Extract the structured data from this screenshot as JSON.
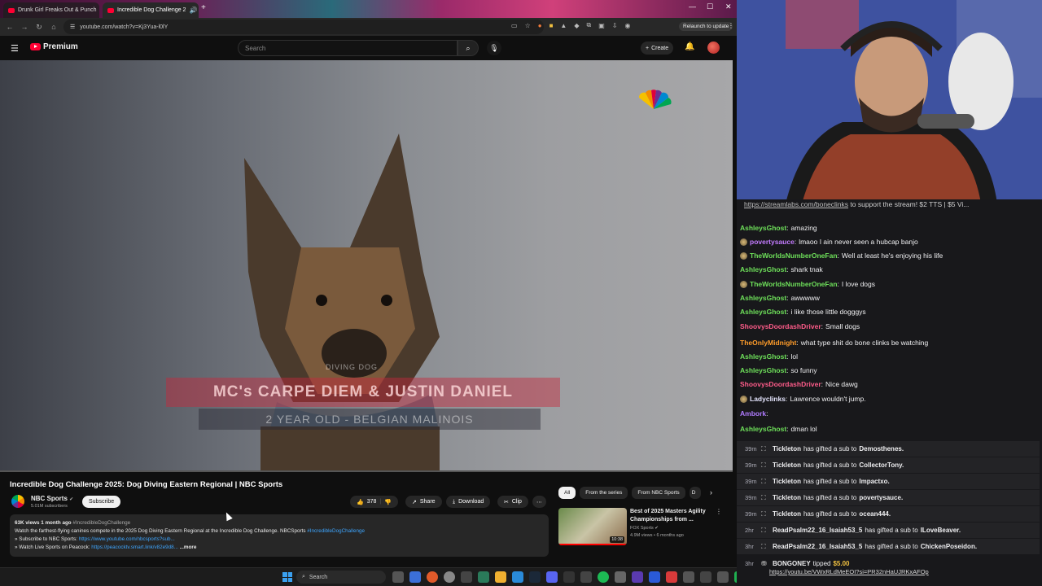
{
  "browser": {
    "tabs": [
      {
        "label": "Drunk Girl Freaks Out & Punch",
        "active": false
      },
      {
        "label": "Incredible Dog Challenge 2",
        "active": true
      }
    ],
    "url": "youtube.com/watch?v=Kj3Yua-l0lY",
    "relaunch_label": "Relaunch to update"
  },
  "youtube": {
    "logo_label": "Premium",
    "search_placeholder": "Search",
    "create_label": "Create",
    "video": {
      "caption_main": "MC's CARPE DIEM & JUSTIN DANIEL",
      "caption_sub": "2 YEAR OLD - BELGIAN MALINOIS",
      "caption_small": "DIVING DOG",
      "title": "Incredible Dog Challenge 2025: Dog Diving Eastern Regional | NBC Sports"
    },
    "channel": {
      "name": "NBC Sports",
      "subscribers": "5.01M subscribers",
      "subscribe_label": "Subscribe"
    },
    "actions": {
      "likes": "378",
      "share": "Share",
      "download": "Download",
      "clip": "Clip"
    },
    "description": {
      "meta": "63K views  1 month ago",
      "meta_tag": "#IncredibleDogChallenge",
      "line1": "Watch the farthest-flying canines compete in the 2025 Dog Diving Eastern Regional at the Incredible Dog Challenge. NBCSports",
      "line1_tag": "#IncredibleDogChallenge",
      "line2": "» Subscribe to NBC Sports:",
      "line2_link": "https://www.youtube.com/nbcsports?sub...",
      "line3": "» Watch Live Sports on Peacock:",
      "line3_link": "https://peacocktv.smart.link/v82e9d8...",
      "more": "...more"
    },
    "chips": [
      "All",
      "From the series",
      "From NBC Sports",
      "D"
    ],
    "recommended": {
      "title": "Best of 2025 Masters Agility Championships from ...",
      "channel": "FOX Sports",
      "meta": "4.9M views • 6 months ago",
      "duration": "10:38"
    }
  },
  "taskbar": {
    "search_label": "Search"
  },
  "chat": {
    "pinned_link": "https://streamlabs.com/boneclinks",
    "pinned_text": " to support the stream! $2 TTS | $5 Vi...",
    "messages": [
      {
        "user": "AshleysGhost",
        "color": "#6ee05a",
        "text": "amazing",
        "badge": false
      },
      {
        "user": "povertysauce",
        "color": "#c37bff",
        "text": "lmaoo I ain never seen a hubcap banjo",
        "badge": true
      },
      {
        "user": "TheWorldsNumberOneFan",
        "color": "#6ee05a",
        "text": "Well at least he's enjoying his life",
        "badge": true
      },
      {
        "user": "AshleysGhost",
        "color": "#6ee05a",
        "text": "shark tnak",
        "badge": false
      },
      {
        "user": "TheWorldsNumberOneFan",
        "color": "#6ee05a",
        "text": "I love dogs",
        "badge": true
      },
      {
        "user": "AshleysGhost",
        "color": "#6ee05a",
        "text": "awwwww",
        "badge": false
      },
      {
        "user": "AshleysGhost",
        "color": "#6ee05a",
        "text": "i like those little dogggys",
        "badge": false
      },
      {
        "user": "ShoovysDoordashDriver",
        "color": "#ff5c8a",
        "text": "Small dogs",
        "badge": false
      },
      {
        "user": "TheOnlyMidnight",
        "color": "#ff9c2a",
        "text": "what type shit do bone clinks be watching",
        "badge": false
      },
      {
        "user": "AshleysGhost",
        "color": "#6ee05a",
        "text": "lol",
        "badge": false
      },
      {
        "user": "AshleysGhost",
        "color": "#6ee05a",
        "text": "so funny",
        "badge": false
      },
      {
        "user": "ShoovysDoordashDriver",
        "color": "#ff5c8a",
        "text": "Nice dawg",
        "badge": false
      },
      {
        "user": "Ladyclinks",
        "color": "#e6e6ff",
        "text": "Lawrence wouldn't jump.",
        "badge": true
      },
      {
        "user": "Ambork",
        "color": "#b07bff",
        "text": "",
        "badge": false
      },
      {
        "user": "AshleysGhost",
        "color": "#6ee05a",
        "text": "dman lol",
        "badge": false
      }
    ],
    "events": [
      {
        "time": "39m",
        "user": "Tickleton",
        "action": "has gifted a sub to",
        "target": "Demosthenes."
      },
      {
        "time": "39m",
        "user": "Tickleton",
        "action": "has gifted a sub to",
        "target": "CollectorTony."
      },
      {
        "time": "39m",
        "user": "Tickleton",
        "action": "has gifted a sub to",
        "target": "Impactxo."
      },
      {
        "time": "39m",
        "user": "Tickleton",
        "action": "has gifted a sub to",
        "target": "povertysauce."
      },
      {
        "time": "39m",
        "user": "Tickleton",
        "action": "has gifted a sub to",
        "target": "ocean444."
      },
      {
        "time": "2hr",
        "user": "ReadPsalm22_16_Isaiah53_5",
        "action": "has gifted a sub to",
        "target": "ILoveBeaver."
      },
      {
        "time": "3hr",
        "user": "ReadPsalm22_16_Isaiah53_5",
        "action": "has gifted a sub to",
        "target": "ChickenPoseidon."
      }
    ],
    "tip": {
      "time": "3hr",
      "user": "BONGONEY",
      "action": "tipped",
      "amount": "$5.00",
      "url": "https://youtu.be/VWxRLdMeEOI?si=PR32nHaUJRKxAFOp"
    }
  },
  "colors": {
    "youtube_red": "#ff0033",
    "link_blue": "#3ea6ff",
    "chat_bg": "#18181b",
    "tip_amount": "#f0c040"
  }
}
